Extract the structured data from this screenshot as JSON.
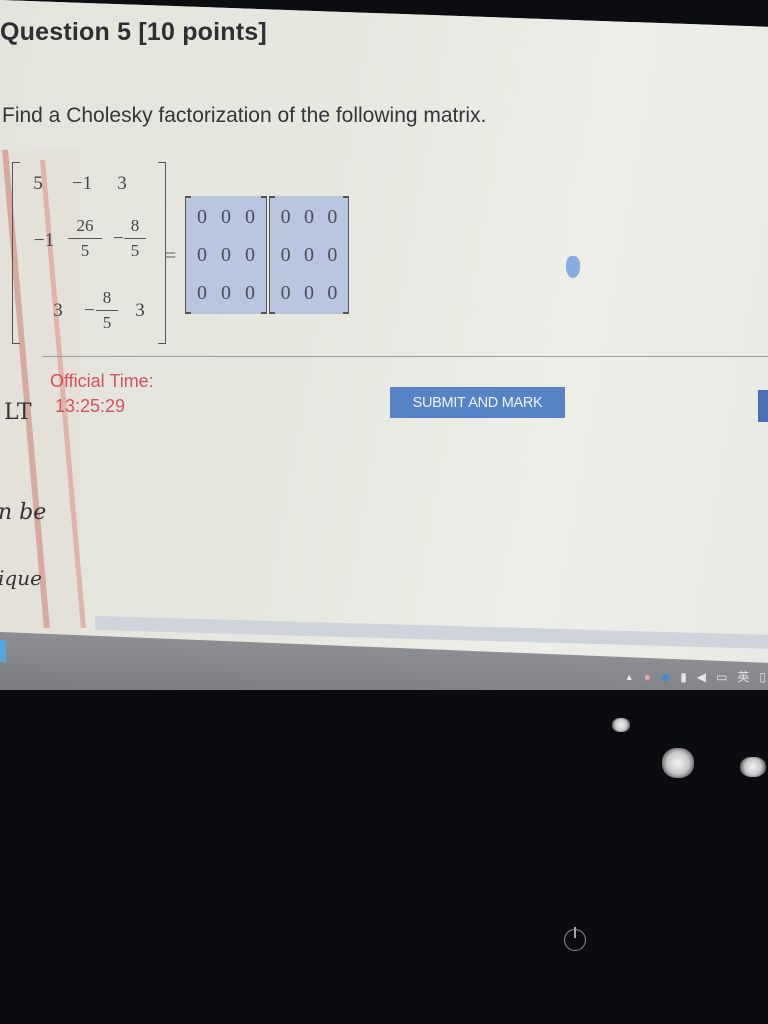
{
  "question": {
    "title": "Question 5 [10 points]",
    "prompt": "Find a Cholesky factorization of the following matrix."
  },
  "matrix_a": {
    "rows": [
      [
        "5",
        "-1",
        "3"
      ],
      [
        "-1",
        "26/5",
        "-8/5"
      ],
      [
        "3",
        "-8/5",
        "3"
      ]
    ],
    "display": {
      "r0c0": "5",
      "r0c1": "−1",
      "r0c2": "3",
      "r1c0": "−1",
      "r1c1_num": "26",
      "r1c1_den": "5",
      "r1c2_sign": "−",
      "r1c2_num": "8",
      "r1c2_den": "5",
      "r2c0": "3",
      "r2c1_sign": "−",
      "r2c1_num": "8",
      "r2c1_den": "5",
      "r2c2": "3"
    }
  },
  "equals": "=",
  "answer_matrix_l": {
    "cells": [
      "0",
      "0",
      "0",
      "0",
      "0",
      "0",
      "0",
      "0",
      "0"
    ]
  },
  "answer_matrix_lt": {
    "cells": [
      "0",
      "0",
      "0",
      "0",
      "0",
      "0",
      "0",
      "0",
      "0"
    ]
  },
  "timer": {
    "label": "Official Time:",
    "value": "13:25:29"
  },
  "submit_button": {
    "label": "SUBMIT AND MARK"
  },
  "handwritten_notes": {
    "symbol": "LT",
    "line1": "n be",
    "line2": "ique"
  },
  "taskbar": {
    "tray_icons": [
      "chevron-up-icon",
      "qq-icon",
      "steam-icon",
      "battery-icon",
      "volume-icon",
      "network-icon",
      "ime-icon",
      "notification-icon"
    ],
    "ime_label": "英"
  },
  "colors": {
    "accent_button": "#5683c5",
    "timer_text": "#d6505a",
    "answer_fill": "#b9c6e0"
  }
}
